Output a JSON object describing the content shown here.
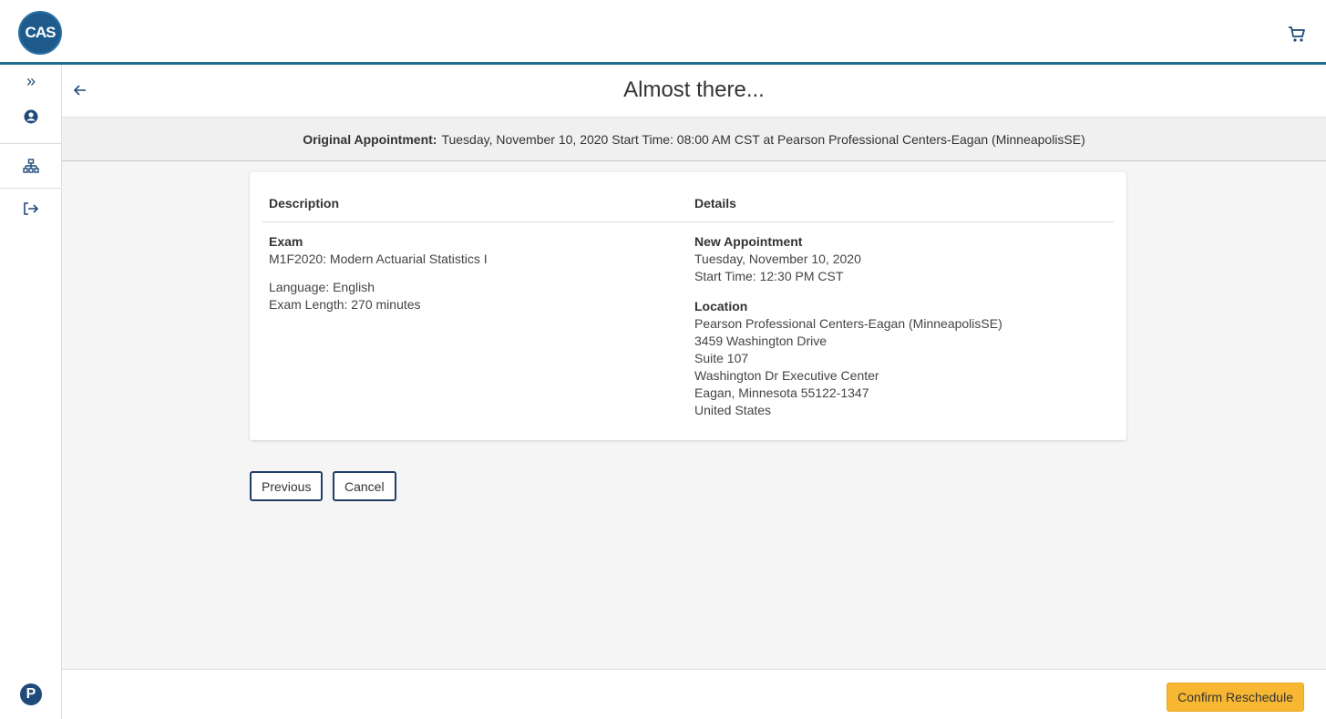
{
  "app": {
    "logo_text": "CAS"
  },
  "page": {
    "title": "Almost there..."
  },
  "original_appointment": {
    "label": "Original Appointment:",
    "text": "Tuesday, November 10, 2020 Start Time: 08:00 AM CST at Pearson Professional Centers-Eagan (MinneapolisSE)"
  },
  "table": {
    "headers": {
      "description": "Description",
      "details": "Details"
    },
    "exam": {
      "label": "Exam",
      "name": "M1F2020: Modern Actuarial Statistics I",
      "language": "Language: English",
      "length": "Exam Length: 270 minutes"
    },
    "new_appointment": {
      "label": "New Appointment",
      "date": "Tuesday, November 10, 2020",
      "start_time": "Start Time: 12:30 PM CST"
    },
    "location": {
      "label": "Location",
      "lines": [
        "Pearson Professional Centers-Eagan (MinneapolisSE)",
        "3459 Washington Drive",
        "Suite 107",
        "Washington Dr Executive Center",
        "Eagan, Minnesota 55122-1347",
        "United States"
      ]
    }
  },
  "buttons": {
    "previous": "Previous",
    "cancel": "Cancel",
    "confirm": "Confirm Reschedule"
  },
  "sidenav": {
    "expand_glyph": "»",
    "icons": [
      "expand-icon",
      "user-icon",
      "sitemap-icon",
      "sign-out-icon"
    ]
  },
  "pearson_logo_glyph": "P",
  "colors": {
    "accent": "#1f6c8f",
    "navy": "#1f4a7a",
    "confirm": "#f7b733"
  }
}
